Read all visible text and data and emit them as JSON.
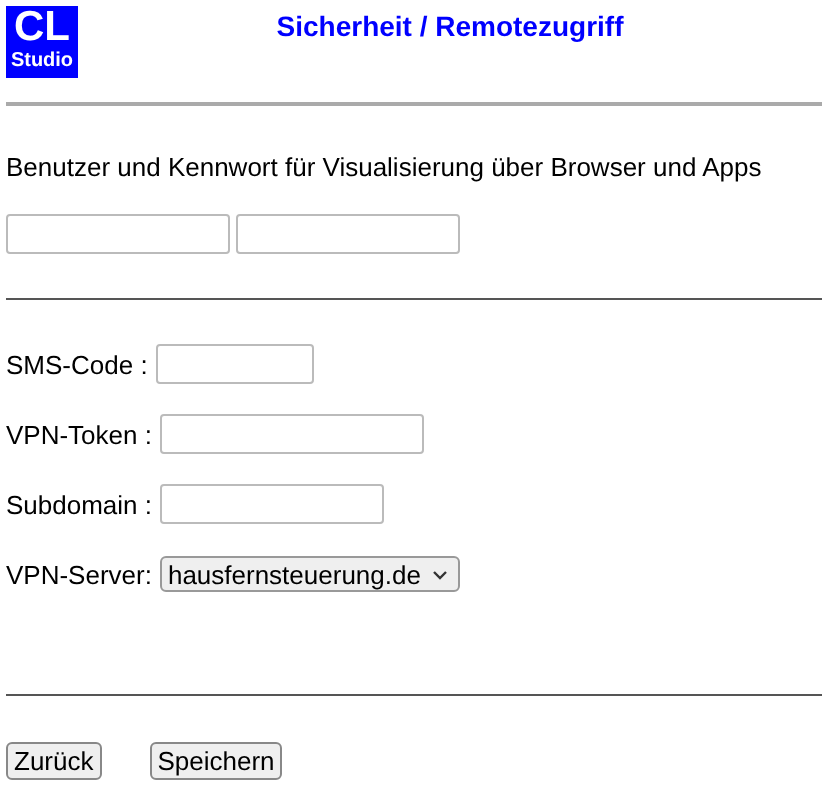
{
  "logo": {
    "line1": "CL",
    "line2": "Studio"
  },
  "title": "Sicherheit / Remotezugriff",
  "description": "Benutzer und Kennwort für Visualisierung über Browser und Apps",
  "credential_fields": [
    {
      "kind": "input"
    },
    {
      "kind": "input"
    }
  ],
  "form_rows": [
    {
      "label": "SMS-Code :",
      "kind": "input"
    },
    {
      "label": "VPN-Token :",
      "kind": "input"
    },
    {
      "label": "Subdomain :",
      "kind": "input"
    },
    {
      "label": "VPN-Server:",
      "kind": "select",
      "value": "hausfernsteuerung.de"
    }
  ],
  "buttons": [
    "Zurück",
    "Speichern"
  ]
}
